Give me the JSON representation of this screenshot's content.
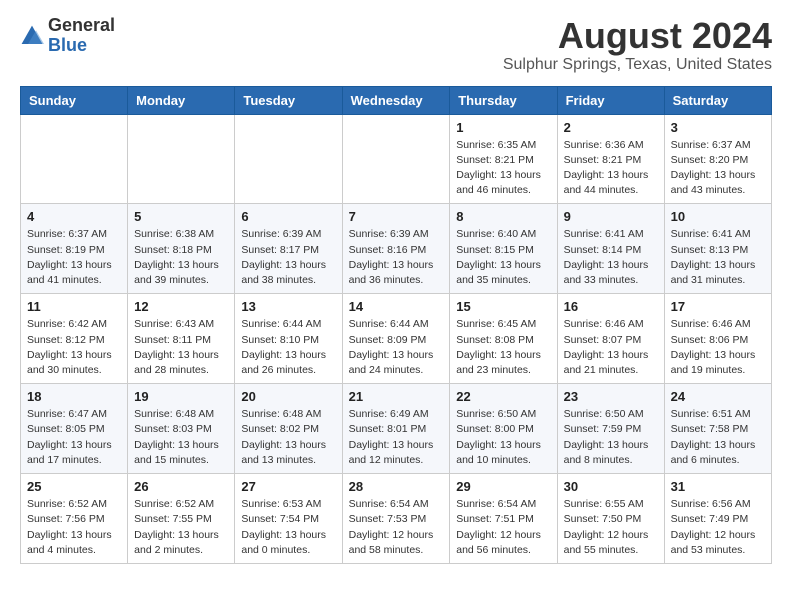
{
  "header": {
    "logo_general": "General",
    "logo_blue": "Blue",
    "month_year": "August 2024",
    "location": "Sulphur Springs, Texas, United States"
  },
  "calendar": {
    "days_of_week": [
      "Sunday",
      "Monday",
      "Tuesday",
      "Wednesday",
      "Thursday",
      "Friday",
      "Saturday"
    ],
    "weeks": [
      [
        {
          "day": "",
          "info": ""
        },
        {
          "day": "",
          "info": ""
        },
        {
          "day": "",
          "info": ""
        },
        {
          "day": "",
          "info": ""
        },
        {
          "day": "1",
          "info": "Sunrise: 6:35 AM\nSunset: 8:21 PM\nDaylight: 13 hours\nand 46 minutes."
        },
        {
          "day": "2",
          "info": "Sunrise: 6:36 AM\nSunset: 8:21 PM\nDaylight: 13 hours\nand 44 minutes."
        },
        {
          "day": "3",
          "info": "Sunrise: 6:37 AM\nSunset: 8:20 PM\nDaylight: 13 hours\nand 43 minutes."
        }
      ],
      [
        {
          "day": "4",
          "info": "Sunrise: 6:37 AM\nSunset: 8:19 PM\nDaylight: 13 hours\nand 41 minutes."
        },
        {
          "day": "5",
          "info": "Sunrise: 6:38 AM\nSunset: 8:18 PM\nDaylight: 13 hours\nand 39 minutes."
        },
        {
          "day": "6",
          "info": "Sunrise: 6:39 AM\nSunset: 8:17 PM\nDaylight: 13 hours\nand 38 minutes."
        },
        {
          "day": "7",
          "info": "Sunrise: 6:39 AM\nSunset: 8:16 PM\nDaylight: 13 hours\nand 36 minutes."
        },
        {
          "day": "8",
          "info": "Sunrise: 6:40 AM\nSunset: 8:15 PM\nDaylight: 13 hours\nand 35 minutes."
        },
        {
          "day": "9",
          "info": "Sunrise: 6:41 AM\nSunset: 8:14 PM\nDaylight: 13 hours\nand 33 minutes."
        },
        {
          "day": "10",
          "info": "Sunrise: 6:41 AM\nSunset: 8:13 PM\nDaylight: 13 hours\nand 31 minutes."
        }
      ],
      [
        {
          "day": "11",
          "info": "Sunrise: 6:42 AM\nSunset: 8:12 PM\nDaylight: 13 hours\nand 30 minutes."
        },
        {
          "day": "12",
          "info": "Sunrise: 6:43 AM\nSunset: 8:11 PM\nDaylight: 13 hours\nand 28 minutes."
        },
        {
          "day": "13",
          "info": "Sunrise: 6:44 AM\nSunset: 8:10 PM\nDaylight: 13 hours\nand 26 minutes."
        },
        {
          "day": "14",
          "info": "Sunrise: 6:44 AM\nSunset: 8:09 PM\nDaylight: 13 hours\nand 24 minutes."
        },
        {
          "day": "15",
          "info": "Sunrise: 6:45 AM\nSunset: 8:08 PM\nDaylight: 13 hours\nand 23 minutes."
        },
        {
          "day": "16",
          "info": "Sunrise: 6:46 AM\nSunset: 8:07 PM\nDaylight: 13 hours\nand 21 minutes."
        },
        {
          "day": "17",
          "info": "Sunrise: 6:46 AM\nSunset: 8:06 PM\nDaylight: 13 hours\nand 19 minutes."
        }
      ],
      [
        {
          "day": "18",
          "info": "Sunrise: 6:47 AM\nSunset: 8:05 PM\nDaylight: 13 hours\nand 17 minutes."
        },
        {
          "day": "19",
          "info": "Sunrise: 6:48 AM\nSunset: 8:03 PM\nDaylight: 13 hours\nand 15 minutes."
        },
        {
          "day": "20",
          "info": "Sunrise: 6:48 AM\nSunset: 8:02 PM\nDaylight: 13 hours\nand 13 minutes."
        },
        {
          "day": "21",
          "info": "Sunrise: 6:49 AM\nSunset: 8:01 PM\nDaylight: 13 hours\nand 12 minutes."
        },
        {
          "day": "22",
          "info": "Sunrise: 6:50 AM\nSunset: 8:00 PM\nDaylight: 13 hours\nand 10 minutes."
        },
        {
          "day": "23",
          "info": "Sunrise: 6:50 AM\nSunset: 7:59 PM\nDaylight: 13 hours\nand 8 minutes."
        },
        {
          "day": "24",
          "info": "Sunrise: 6:51 AM\nSunset: 7:58 PM\nDaylight: 13 hours\nand 6 minutes."
        }
      ],
      [
        {
          "day": "25",
          "info": "Sunrise: 6:52 AM\nSunset: 7:56 PM\nDaylight: 13 hours\nand 4 minutes."
        },
        {
          "day": "26",
          "info": "Sunrise: 6:52 AM\nSunset: 7:55 PM\nDaylight: 13 hours\nand 2 minutes."
        },
        {
          "day": "27",
          "info": "Sunrise: 6:53 AM\nSunset: 7:54 PM\nDaylight: 13 hours\nand 0 minutes."
        },
        {
          "day": "28",
          "info": "Sunrise: 6:54 AM\nSunset: 7:53 PM\nDaylight: 12 hours\nand 58 minutes."
        },
        {
          "day": "29",
          "info": "Sunrise: 6:54 AM\nSunset: 7:51 PM\nDaylight: 12 hours\nand 56 minutes."
        },
        {
          "day": "30",
          "info": "Sunrise: 6:55 AM\nSunset: 7:50 PM\nDaylight: 12 hours\nand 55 minutes."
        },
        {
          "day": "31",
          "info": "Sunrise: 6:56 AM\nSunset: 7:49 PM\nDaylight: 12 hours\nand 53 minutes."
        }
      ]
    ]
  }
}
